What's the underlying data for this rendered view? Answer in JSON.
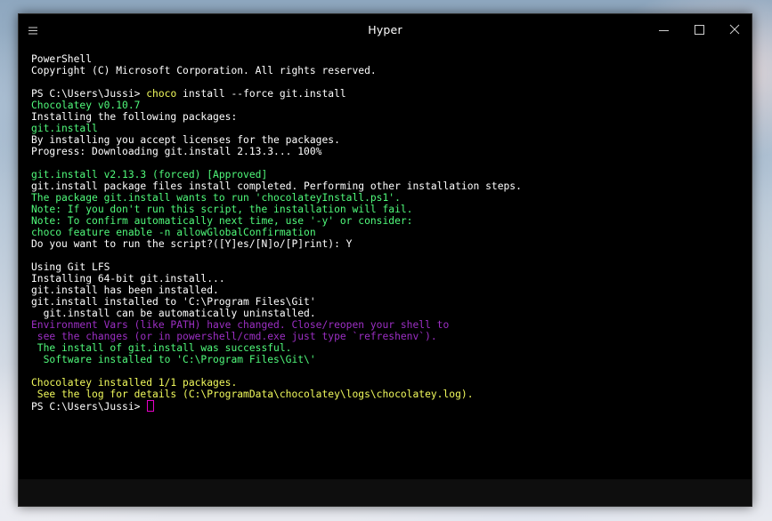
{
  "window": {
    "title": "Hyper",
    "menu_icon": "hamburger-menu-icon",
    "controls": {
      "minimize_icon": "minimize-icon",
      "maximize_icon": "maximize-icon",
      "close_icon": "close-icon"
    }
  },
  "colors": {
    "default": "#ffffff",
    "green": "#50fa7b",
    "yellow": "#f1fa5c",
    "purple": "#9c2fc4",
    "cursor": "#e600c8"
  },
  "terminal": {
    "lines": [
      {
        "text": "PowerShell",
        "color": "w"
      },
      {
        "text": "Copyright (C) Microsoft Corporation. All rights reserved.",
        "color": "w"
      },
      {
        "text": "",
        "color": "w"
      },
      {
        "segments": [
          {
            "text": "PS C:\\Users\\Jussi> ",
            "color": "w"
          },
          {
            "text": "choco",
            "color": "y"
          },
          {
            "text": " install --force git.install",
            "color": "w"
          }
        ]
      },
      {
        "text": "Chocolatey v0.10.7",
        "color": "g"
      },
      {
        "text": "Installing the following packages:",
        "color": "w"
      },
      {
        "text": "git.install",
        "color": "g"
      },
      {
        "text": "By installing you accept licenses for the packages.",
        "color": "w"
      },
      {
        "text": "Progress: Downloading git.install 2.13.3... 100%",
        "color": "w"
      },
      {
        "text": "",
        "color": "w"
      },
      {
        "text": "git.install v2.13.3 (forced) [Approved]",
        "color": "g"
      },
      {
        "text": "git.install package files install completed. Performing other installation steps.",
        "color": "w"
      },
      {
        "text": "The package git.install wants to run 'chocolateyInstall.ps1'.",
        "color": "g"
      },
      {
        "text": "Note: If you don't run this script, the installation will fail.",
        "color": "g"
      },
      {
        "text": "Note: To confirm automatically next time, use '-y' or consider:",
        "color": "g"
      },
      {
        "text": "choco feature enable -n allowGlobalConfirmation",
        "color": "g"
      },
      {
        "text": "Do you want to run the script?([Y]es/[N]o/[P]rint): Y",
        "color": "w"
      },
      {
        "text": "",
        "color": "w"
      },
      {
        "text": "Using Git LFS",
        "color": "w"
      },
      {
        "text": "Installing 64-bit git.install...",
        "color": "w"
      },
      {
        "text": "git.install has been installed.",
        "color": "w"
      },
      {
        "text": "git.install installed to 'C:\\Program Files\\Git'",
        "color": "w"
      },
      {
        "text": "  git.install can be automatically uninstalled.",
        "color": "w"
      },
      {
        "text": "Environment Vars (like PATH) have changed. Close/reopen your shell to",
        "color": "p"
      },
      {
        "text": " see the changes (or in powershell/cmd.exe just type `refreshenv`).",
        "color": "p"
      },
      {
        "text": " The install of git.install was successful.",
        "color": "g"
      },
      {
        "text": "  Software installed to 'C:\\Program Files\\Git\\'",
        "color": "g"
      },
      {
        "text": "",
        "color": "w"
      },
      {
        "text": "Chocolatey installed 1/1 packages.",
        "color": "y"
      },
      {
        "text": " See the log for details (C:\\ProgramData\\chocolatey\\logs\\chocolatey.log).",
        "color": "y"
      },
      {
        "segments": [
          {
            "text": "PS C:\\Users\\Jussi> ",
            "color": "w"
          }
        ],
        "cursor": true
      }
    ]
  }
}
